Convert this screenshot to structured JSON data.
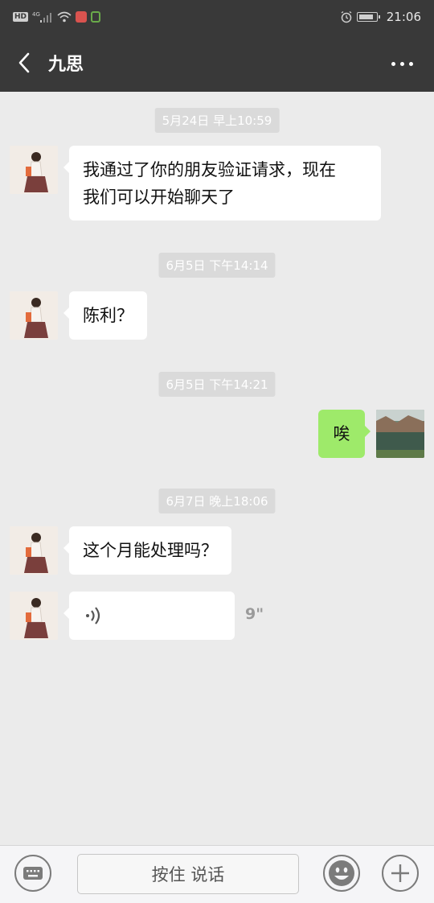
{
  "status_bar": {
    "network_badge": "HD",
    "network_type": "4G",
    "time": "21:06",
    "icons": [
      "hd-icon",
      "signal-icon",
      "wifi-icon",
      "app-notification-icon",
      "lock-icon",
      "alarm-icon",
      "battery-icon"
    ]
  },
  "header": {
    "title": "九思",
    "back_icon": "chevron-left-icon",
    "more_icon": "more-dots-icon"
  },
  "messages": [
    {
      "type": "timestamp",
      "text": "5月24日 早上10:59"
    },
    {
      "type": "text",
      "side": "left",
      "text_lines": [
        "我通过了你的朋友验证请求，现在",
        "我们可以开始聊天了"
      ]
    },
    {
      "type": "timestamp",
      "text": "6月5日 下午14:14"
    },
    {
      "type": "text",
      "side": "left",
      "text": "陈利？"
    },
    {
      "type": "timestamp",
      "text": "6月5日 下午14:21"
    },
    {
      "type": "text",
      "side": "right",
      "text": "唉"
    },
    {
      "type": "timestamp",
      "text": "6月7日 晚上18:06"
    },
    {
      "type": "text",
      "side": "left",
      "text": "这个月能处理吗？"
    },
    {
      "type": "voice",
      "side": "left",
      "duration": "9\""
    }
  ],
  "input_bar": {
    "keyboard_icon": "keyboard-icon",
    "hold_to_talk_label": "按住 说话",
    "emoji_icon": "emoji-icon",
    "plus_icon": "plus-icon"
  },
  "colors": {
    "header_bg": "#393939",
    "chat_bg": "#ebebeb",
    "bubble_self": "#9eea6a",
    "bubble_other": "#ffffff",
    "timestamp_bg": "#dadada"
  }
}
